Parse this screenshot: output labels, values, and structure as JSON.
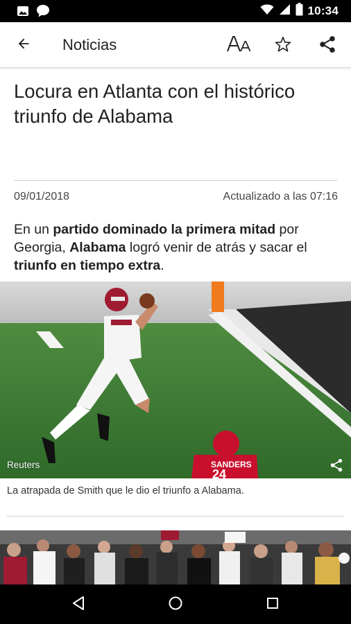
{
  "status_bar": {
    "time": "10:34",
    "icons": [
      "image-icon",
      "chat-icon",
      "wifi-icon",
      "signal-icon",
      "battery-icon"
    ]
  },
  "app_bar": {
    "title": "Noticias",
    "back_icon": "arrow-back-icon",
    "font_size_label": "AA",
    "actions": [
      "font-size-icon",
      "star-icon",
      "share-icon"
    ]
  },
  "article": {
    "headline": "Locura en Atlanta con el histórico triunfo de Alabama",
    "date": "09/01/2018",
    "updated": "Actualizado a las 07:16",
    "summary_parts": {
      "p1": "En un ",
      "b1": "partido dominado la primera mitad",
      "p2": " por Georgia, ",
      "b2": "Alabama",
      "p3": " logró venir de atrás y sacar el ",
      "b3": "triunfo en tiempo extra",
      "p4": "."
    },
    "photo": {
      "credit": "Reuters",
      "caption": "La atrapada de Smith que le dio el triunfo a Alabama.",
      "jersey_text": "SANDERS",
      "jersey_number": "24"
    }
  },
  "colors": {
    "status_bar": "#000000",
    "nav_bar": "#000000",
    "text": "#212121",
    "field_green": "#3d7a35",
    "alabama_crimson": "#9e1b32",
    "georgia_red": "#c8102e"
  }
}
